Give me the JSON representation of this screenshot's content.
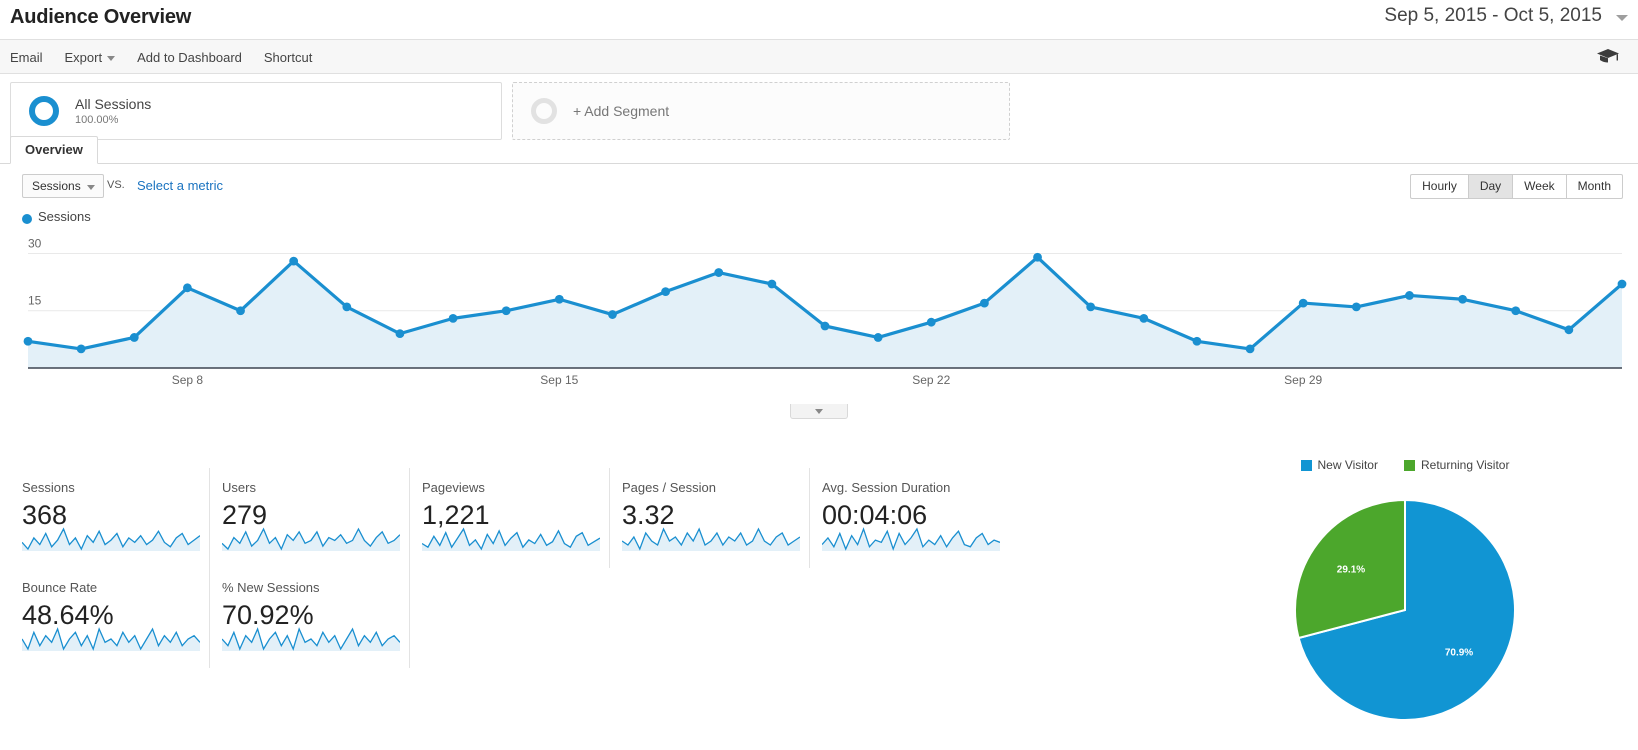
{
  "header": {
    "title": "Audience Overview",
    "date_range": "Sep 5, 2015 - Oct 5, 2015"
  },
  "toolbar": {
    "email": "Email",
    "export": "Export",
    "add_to_dashboard": "Add to Dashboard",
    "shortcut": "Shortcut"
  },
  "segments": {
    "all_sessions_label": "All Sessions",
    "all_sessions_percent": "100.00%",
    "add_segment_label": "+ Add Segment"
  },
  "tabs": [
    {
      "label": "Overview",
      "active": true
    }
  ],
  "chart_controls": {
    "metric_selected": "Sessions",
    "vs_label": "VS.",
    "select_metric_link": "Select a metric",
    "granularity": [
      {
        "label": "Hourly",
        "active": false
      },
      {
        "label": "Day",
        "active": true
      },
      {
        "label": "Week",
        "active": false
      },
      {
        "label": "Month",
        "active": false
      }
    ]
  },
  "colors": {
    "line_blue": "#1a8fd0",
    "area_blue": "#e3f0f8",
    "pie_blue": "#1195d3",
    "pie_green": "#4ca72c",
    "link_blue": "#1a73c0"
  },
  "chart_data": {
    "type": "line",
    "title": "Sessions",
    "xlabel": "",
    "ylabel": "Sessions",
    "ylim": [
      0,
      33
    ],
    "yticks": [
      15,
      30
    ],
    "grid": true,
    "legend": [
      "Sessions"
    ],
    "legend_position": "top-left",
    "x": [
      "Sep 5",
      "Sep 6",
      "Sep 7",
      "Sep 8",
      "Sep 9",
      "Sep 10",
      "Sep 11",
      "Sep 12",
      "Sep 13",
      "Sep 14",
      "Sep 15",
      "Sep 16",
      "Sep 17",
      "Sep 18",
      "Sep 19",
      "Sep 20",
      "Sep 21",
      "Sep 22",
      "Sep 23",
      "Sep 24",
      "Sep 25",
      "Sep 26",
      "Sep 27",
      "Sep 28",
      "Sep 29",
      "Sep 30",
      "Oct 1",
      "Oct 2",
      "Oct 3",
      "Oct 4",
      "Oct 5"
    ],
    "tick_labels": [
      "Sep 8",
      "Sep 15",
      "Sep 22",
      "Sep 29"
    ],
    "tick_indices": [
      3,
      10,
      17,
      24
    ],
    "values": [
      7,
      5,
      8,
      21,
      15,
      28,
      16,
      9,
      13,
      15,
      18,
      14,
      20,
      25,
      22,
      11,
      8,
      12,
      17,
      29,
      16,
      13,
      7,
      5,
      17,
      16,
      19,
      18,
      15,
      10,
      22
    ]
  },
  "metrics": [
    {
      "label": "Sessions",
      "value": "368",
      "spark": [
        10,
        7,
        12,
        9,
        14,
        8,
        11,
        16,
        9,
        12,
        7,
        13,
        10,
        15,
        9,
        11,
        14,
        8,
        12,
        10,
        13,
        9,
        11,
        15,
        10,
        8,
        12,
        14,
        9,
        11,
        13
      ]
    },
    {
      "label": "Users",
      "value": "279",
      "spark": [
        8,
        6,
        10,
        8,
        12,
        7,
        9,
        13,
        8,
        10,
        6,
        11,
        9,
        12,
        8,
        9,
        12,
        7,
        10,
        9,
        11,
        8,
        9,
        13,
        9,
        7,
        10,
        12,
        8,
        9,
        11
      ]
    },
    {
      "label": "Pageviews",
      "value": "1,221",
      "spark": [
        9,
        7,
        13,
        8,
        15,
        7,
        12,
        17,
        8,
        11,
        6,
        14,
        9,
        16,
        8,
        12,
        15,
        7,
        11,
        9,
        14,
        8,
        10,
        16,
        9,
        7,
        13,
        15,
        8,
        10,
        12
      ]
    },
    {
      "label": "Pages / Session",
      "value": "3.32",
      "spark": [
        10,
        9,
        11,
        8,
        12,
        10,
        9,
        13,
        10,
        11,
        9,
        12,
        10,
        13,
        9,
        10,
        12,
        9,
        11,
        10,
        12,
        9,
        10,
        13,
        10,
        9,
        11,
        12,
        9,
        10,
        11
      ]
    },
    {
      "label": "Avg. Session Duration",
      "value": "00:04:06",
      "spark": [
        9,
        12,
        8,
        14,
        7,
        13,
        9,
        16,
        8,
        11,
        10,
        15,
        7,
        14,
        9,
        12,
        16,
        8,
        11,
        9,
        13,
        8,
        12,
        15,
        9,
        8,
        12,
        14,
        9,
        11,
        10
      ]
    },
    {
      "label": "Bounce Rate",
      "value": "48.64%",
      "spark": [
        11,
        8,
        13,
        9,
        12,
        10,
        14,
        8,
        11,
        13,
        9,
        12,
        8,
        14,
        10,
        11,
        9,
        13,
        10,
        12,
        8,
        11,
        14,
        9,
        12,
        10,
        13,
        9,
        11,
        12,
        10
      ]
    },
    {
      "label": "% New Sessions",
      "value": "70.92%",
      "spark": [
        12,
        10,
        14,
        9,
        13,
        11,
        15,
        9,
        12,
        14,
        10,
        13,
        9,
        15,
        11,
        12,
        10,
        14,
        11,
        13,
        9,
        12,
        15,
        10,
        13,
        11,
        14,
        10,
        12,
        13,
        11
      ]
    }
  ],
  "pie": {
    "legend": [
      {
        "label": "New Visitor",
        "color": "#1195d3"
      },
      {
        "label": "Returning Visitor",
        "color": "#4ca72c"
      }
    ],
    "chart_data": {
      "type": "pie",
      "labels": [
        "New Visitor",
        "Returning Visitor"
      ],
      "values": [
        70.9,
        29.1
      ],
      "value_labels": [
        "70.9%",
        "29.1%"
      ],
      "colors": [
        "#1195d3",
        "#4ca72c"
      ]
    }
  }
}
